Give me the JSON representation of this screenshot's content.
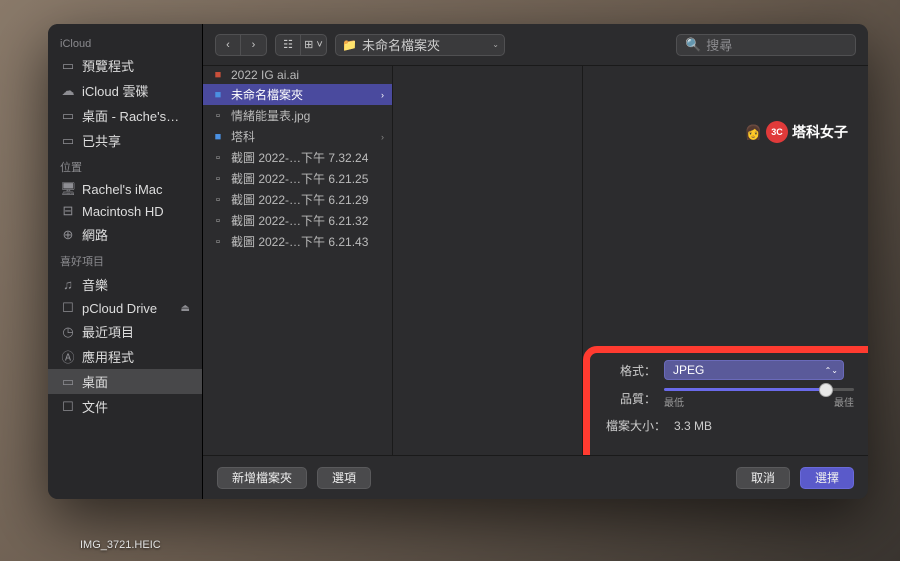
{
  "backdrop": {
    "thumb_filename": "IMG_3721.HEIC"
  },
  "sidebar": {
    "sections": [
      {
        "title": "iCloud",
        "items": [
          {
            "icon": "folder-icon",
            "glyph": "▭",
            "label": "預覽程式"
          },
          {
            "icon": "cloud-icon",
            "glyph": "☁",
            "label": "iCloud 雲碟"
          },
          {
            "icon": "desktop-icon",
            "glyph": "▭",
            "label": "桌面 - Rache's…"
          },
          {
            "icon": "shared-icon",
            "glyph": "▭",
            "label": "已共享"
          }
        ]
      },
      {
        "title": "位置",
        "items": [
          {
            "icon": "imac-icon",
            "glyph": "🖥",
            "label": "Rachel's iMac"
          },
          {
            "icon": "disk-icon",
            "glyph": "⊟",
            "label": "Macintosh HD"
          },
          {
            "icon": "network-icon",
            "glyph": "⊕",
            "label": "網路"
          }
        ]
      },
      {
        "title": "喜好項目",
        "items": [
          {
            "icon": "music-icon",
            "glyph": "♫",
            "label": "音樂"
          },
          {
            "icon": "doc-icon",
            "glyph": "☐",
            "label": "pCloud Drive",
            "eject": true
          },
          {
            "icon": "recent-icon",
            "glyph": "◷",
            "label": "最近項目"
          },
          {
            "icon": "apps-icon",
            "glyph": "Ⓐ",
            "label": "應用程式"
          },
          {
            "icon": "desktop-icon",
            "glyph": "▭",
            "label": "桌面",
            "selected": true
          },
          {
            "icon": "documents-icon",
            "glyph": "☐",
            "label": "文件"
          }
        ]
      }
    ]
  },
  "toolbar": {
    "path_label": "未命名檔案夾",
    "search_placeholder": "搜尋"
  },
  "column": {
    "items": [
      {
        "icon": "ai-file-icon",
        "glyph": "■",
        "color": "#c94f3a",
        "name": "2022 IG ai.ai"
      },
      {
        "icon": "folder-icon",
        "glyph": "■",
        "color": "#4a90e2",
        "name": "未命名檔案夾",
        "folder": true,
        "selected": true
      },
      {
        "icon": "image-file-icon",
        "glyph": "▫",
        "color": "#888",
        "name": "情緒能量表.jpg"
      },
      {
        "icon": "folder-icon",
        "glyph": "■",
        "color": "#4a90e2",
        "name": "塔科",
        "folder": true
      },
      {
        "icon": "image-file-icon",
        "glyph": "▫",
        "color": "#888",
        "name": "截圖 2022-…下午 7.32.24"
      },
      {
        "icon": "image-file-icon",
        "glyph": "▫",
        "color": "#888",
        "name": "截圖 2022-…下午 6.21.25"
      },
      {
        "icon": "image-file-icon",
        "glyph": "▫",
        "color": "#888",
        "name": "截圖 2022-…下午 6.21.29"
      },
      {
        "icon": "image-file-icon",
        "glyph": "▫",
        "color": "#888",
        "name": "截圖 2022-…下午 6.21.32"
      },
      {
        "icon": "image-file-icon",
        "glyph": "▫",
        "color": "#888",
        "name": "截圖 2022-…下午 6.21.43"
      }
    ]
  },
  "options": {
    "format_label": "格式：",
    "format_value": "JPEG",
    "quality_label": "品質：",
    "quality_min": "最低",
    "quality_max": "最佳",
    "filesize_label": "檔案大小：",
    "filesize_value": "3.3 MB"
  },
  "footer": {
    "new_folder": "新增檔案夾",
    "options": "選項",
    "cancel": "取消",
    "choose": "選擇"
  },
  "watermark": {
    "text": "塔科女子",
    "badge": "3C"
  }
}
